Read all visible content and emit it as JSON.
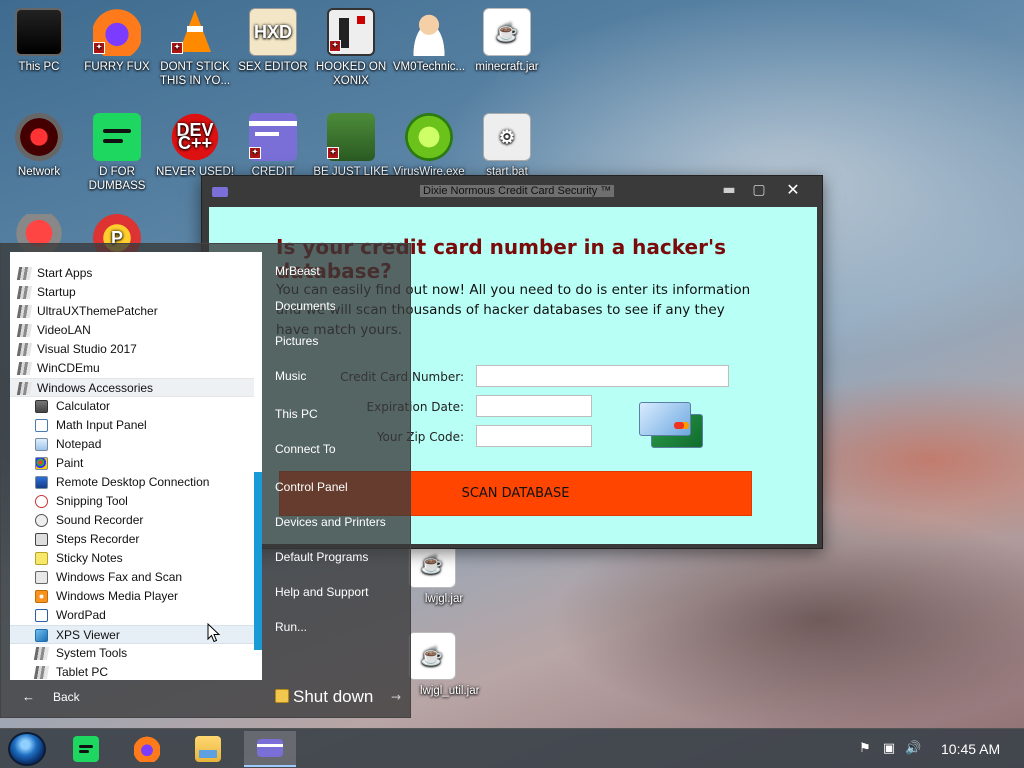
{
  "desktop": {
    "icons": [
      {
        "label": "This PC"
      },
      {
        "label": "FURRY FUX"
      },
      {
        "label": "DONT STICK THIS IN YO..."
      },
      {
        "label": "SEX EDITOR"
      },
      {
        "label": "HOOKED ON XONIX"
      },
      {
        "label": "VM0Technic..."
      },
      {
        "label": "minecraft.jar"
      },
      {
        "label": "Network"
      },
      {
        "label": "D FOR DUMBASS"
      },
      {
        "label": "NEVER USED!"
      },
      {
        "label": "CREDIT CARD"
      },
      {
        "label": "BE JUST LIKE"
      },
      {
        "label": "VirusWire.exe"
      },
      {
        "label": "start.bat"
      },
      {
        "label": "lwjgl.jar"
      },
      {
        "label": "lwjgl_util.jar"
      }
    ],
    "icon_glyphs": {
      "hxd": "HXD",
      "dev": "DEV C++",
      "java": "☕",
      "gear": "⚙",
      "p": "P",
      "shield": "✦"
    }
  },
  "window": {
    "title": "Dixie Normous Credit Card Security ™",
    "controls": {
      "minimize": "▬",
      "maximize": "▢",
      "close": "✕"
    },
    "heading": "Is your credit card number in a hacker's database?",
    "description": "You can easily find out now! All you need to do is enter its information and we will scan thousands of hacker databases to see if any they have match yours.",
    "fields": [
      {
        "label": "Credit Card Number:",
        "value": ""
      },
      {
        "label": "Expiration Date:",
        "value": ""
      },
      {
        "label": "Your Zip Code:",
        "value": ""
      }
    ],
    "scan_button": "SCAN DATABASE"
  },
  "start_menu": {
    "programs": [
      {
        "label": "Start Apps",
        "kind": "folder"
      },
      {
        "label": "Startup",
        "kind": "folder"
      },
      {
        "label": "UltraUXThemePatcher",
        "kind": "folder"
      },
      {
        "label": "VideoLAN",
        "kind": "folder"
      },
      {
        "label": "Visual Studio 2017",
        "kind": "folder"
      },
      {
        "label": "WinCDEmu",
        "kind": "folder"
      },
      {
        "label": "Windows Accessories",
        "kind": "folder"
      },
      {
        "label": "Calculator",
        "kind": "app"
      },
      {
        "label": "Math Input Panel",
        "kind": "app"
      },
      {
        "label": "Notepad",
        "kind": "app"
      },
      {
        "label": "Paint",
        "kind": "app"
      },
      {
        "label": "Remote Desktop Connection",
        "kind": "app"
      },
      {
        "label": "Snipping Tool",
        "kind": "app"
      },
      {
        "label": "Sound Recorder",
        "kind": "app"
      },
      {
        "label": "Steps Recorder",
        "kind": "app"
      },
      {
        "label": "Sticky Notes",
        "kind": "app"
      },
      {
        "label": "Windows Fax and Scan",
        "kind": "app"
      },
      {
        "label": "Windows Media Player",
        "kind": "app"
      },
      {
        "label": "WordPad",
        "kind": "app"
      },
      {
        "label": "XPS Viewer",
        "kind": "app"
      },
      {
        "label": "System Tools",
        "kind": "folder"
      },
      {
        "label": "Tablet PC",
        "kind": "folder"
      }
    ],
    "back": {
      "arrow": "←",
      "label": "Back"
    },
    "right_column": [
      {
        "label": "MrBeast"
      },
      {
        "label": "Documents"
      },
      {
        "label": "Pictures"
      },
      {
        "label": "Music"
      },
      {
        "label": "This PC"
      },
      {
        "label": "Connect To"
      },
      {
        "label": "Control Panel"
      },
      {
        "label": "Devices and Printers"
      },
      {
        "label": "Default Programs"
      },
      {
        "label": "Help and Support"
      },
      {
        "label": "Run..."
      }
    ],
    "shutdown": {
      "label": "Shut down",
      "arrow": "→"
    }
  },
  "taskbar": {
    "tray": {
      "flag": "⚑",
      "network": "▣",
      "volume": "🔊"
    },
    "clock": "10:45 AM"
  }
}
